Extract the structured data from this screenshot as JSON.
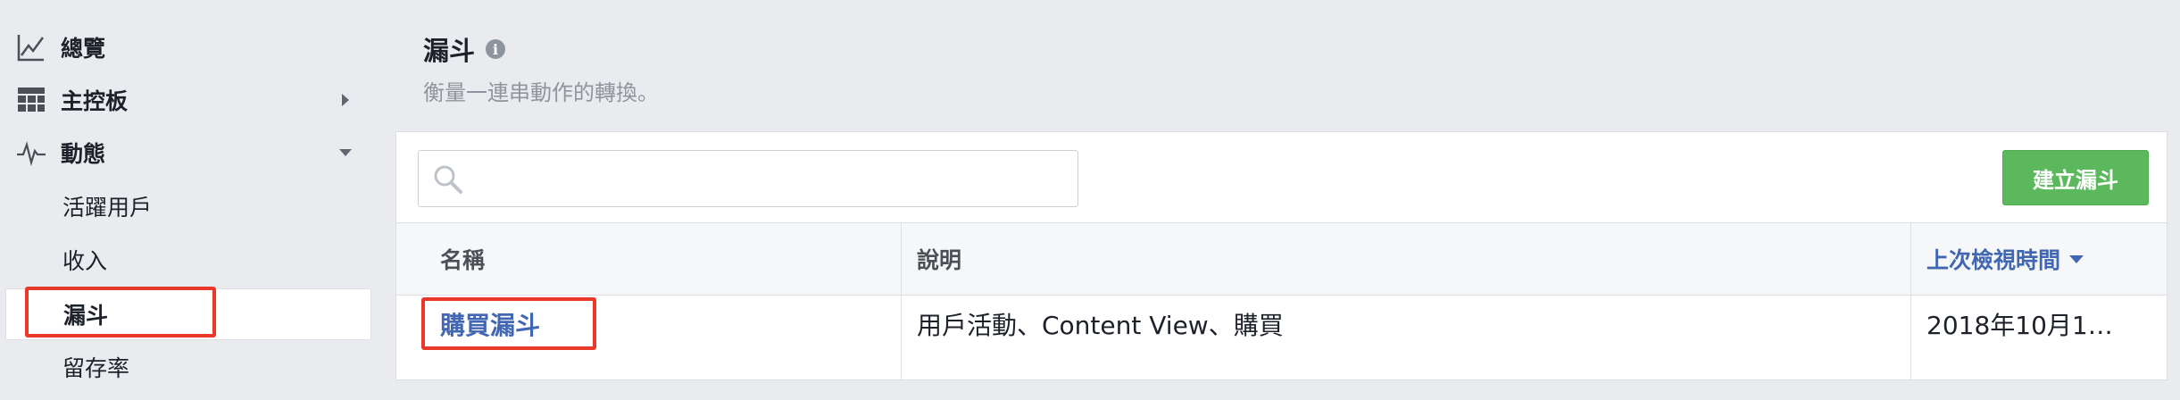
{
  "sidebar": {
    "items": [
      {
        "label": "總覽",
        "icon": "line-chart-icon"
      },
      {
        "label": "主控板",
        "icon": "grid-icon"
      },
      {
        "label": "動態",
        "icon": "pulse-icon"
      }
    ],
    "sub_items": [
      {
        "label": "活躍用戶"
      },
      {
        "label": "收入"
      },
      {
        "label": "漏斗"
      },
      {
        "label": "留存率"
      }
    ],
    "active_item": "漏斗"
  },
  "header": {
    "title": "漏斗",
    "info_icon": "i",
    "subtitle": "衡量一連串動作的轉換。"
  },
  "toolbar": {
    "search_placeholder": "",
    "search_value": "",
    "create_label": "建立漏斗"
  },
  "table": {
    "columns": [
      "名稱",
      "說明",
      "上次檢視時間"
    ],
    "sorted_column": "上次檢視時間",
    "rows": [
      {
        "name": "購買漏斗",
        "description": "用戶活動、Content View、購買",
        "last_viewed": "2018年10月1…"
      }
    ]
  },
  "colors": {
    "accent": "#4267b2",
    "button_green": "#5cb85c",
    "highlight_red": "#e8392b",
    "background": "#e9ebee"
  }
}
